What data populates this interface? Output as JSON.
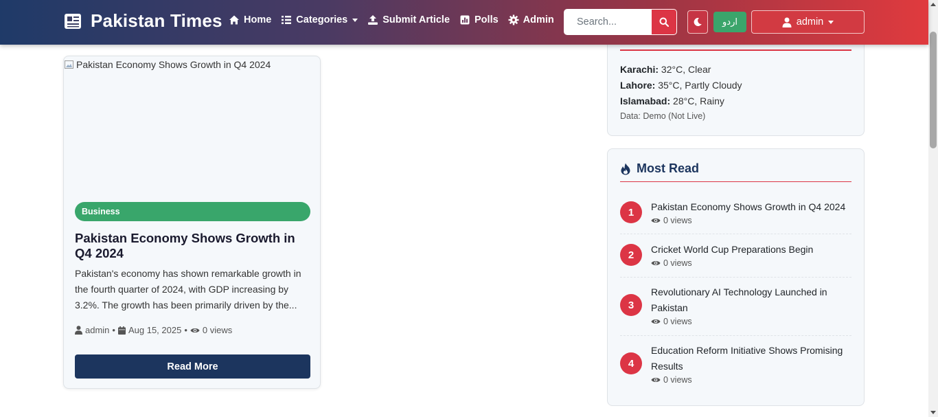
{
  "nav": {
    "brand": "Pakistan Times",
    "links": [
      "Home",
      "Categories",
      "Submit Article",
      "Polls",
      "Admin"
    ],
    "search_placeholder": "Search...",
    "lang_button": "اردو",
    "user": "admin"
  },
  "article": {
    "image_alt": "Pakistan Economy Shows Growth in Q4 2024",
    "category": "Business",
    "title": "Pakistan Economy Shows Growth in Q4 2024",
    "excerpt": "Pakistan's economy has shown remarkable growth in the fourth quarter of 2024, with GDP increasing by 3.2%. The growth has been primarily driven by the...",
    "author": "admin",
    "date": "Aug 15, 2025",
    "views": "0 views",
    "read_more": "Read More"
  },
  "weather": {
    "rows": [
      {
        "city": "Karachi:",
        "value": " 32°C, Clear"
      },
      {
        "city": "Lahore:",
        "value": " 35°C, Partly Cloudy"
      },
      {
        "city": "Islamabad:",
        "value": " 28°C, Rainy"
      }
    ],
    "note": "Data: Demo (Not Live)"
  },
  "most_read": {
    "title": "Most Read",
    "items": [
      {
        "rank": "1",
        "title": "Pakistan Economy Shows Growth in Q4 2024",
        "views": "0 views"
      },
      {
        "rank": "2",
        "title": "Cricket World Cup Preparations Begin",
        "views": "0 views"
      },
      {
        "rank": "3",
        "title": "Revolutionary AI Technology Launched in Pakistan",
        "views": "0 views"
      },
      {
        "rank": "4",
        "title": "Education Reform Initiative Shows Promising Results",
        "views": "0 views"
      }
    ]
  },
  "colors": {
    "brand_navy": "#1c355e",
    "accent_red": "#dc3545",
    "badge_green": "#39a66b"
  }
}
